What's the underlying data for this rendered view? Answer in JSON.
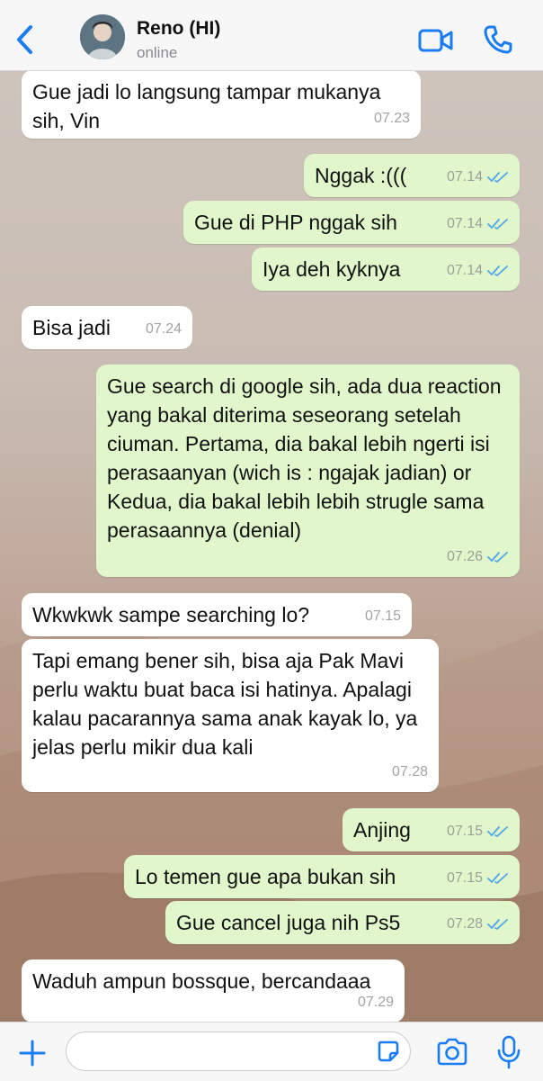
{
  "header": {
    "back_label": "Back",
    "contact_name": "Reno (HI)",
    "status": "online"
  },
  "messages": [
    {
      "side": "in",
      "text": "Gue jadi lo langsung tampar mukanya sih, Vin",
      "time": "07.23",
      "read": false
    },
    {
      "side": "out",
      "text": "Nggak :(((",
      "time": "07.14",
      "read": true
    },
    {
      "side": "out",
      "text": "Gue di PHP nggak sih",
      "time": "07.14",
      "read": true
    },
    {
      "side": "out",
      "text": "Iya deh kyknya",
      "time": "07.14",
      "read": true
    },
    {
      "side": "in",
      "text": "Bisa jadi",
      "time": "07.24",
      "read": false
    },
    {
      "side": "out",
      "text": "Gue search di google sih, ada dua reaction yang bakal diterima seseorang setelah ciuman. Pertama, dia bakal lebih ngerti isi perasaanyan (wich is : ngajak jadian) or Kedua, dia bakal lebih lebih strugle sama perasaannya (denial)",
      "time": "07.26",
      "read": true
    },
    {
      "side": "in",
      "text": "Wkwkwk sampe searching lo?",
      "time": "07.15",
      "read": false
    },
    {
      "side": "in",
      "text": "Tapi emang bener sih, bisa aja Pak Mavi perlu waktu buat baca isi hatinya. Apalagi kalau pacarannya sama anak kayak lo, ya jelas perlu mikir dua kali",
      "time": "07.28",
      "read": false
    },
    {
      "side": "out",
      "text": "Anjing",
      "time": "07.15",
      "read": true
    },
    {
      "side": "out",
      "text": "Lo temen gue apa bukan sih",
      "time": "07.15",
      "read": true
    },
    {
      "side": "out",
      "text": "Gue cancel juga nih Ps5",
      "time": "07.28",
      "read": true
    },
    {
      "side": "in",
      "text": "Waduh ampun bossque, bercandaaa",
      "time": "07.29",
      "read": false
    }
  ],
  "footer": {
    "input_value": "",
    "input_placeholder": ""
  },
  "colors": {
    "accent": "#1a7cf5",
    "incoming_bubble": "#ffffff",
    "outgoing_bubble": "#e1f7cb",
    "read_ticks": "#4fa6ec",
    "timestamp": "#9aa19a"
  }
}
